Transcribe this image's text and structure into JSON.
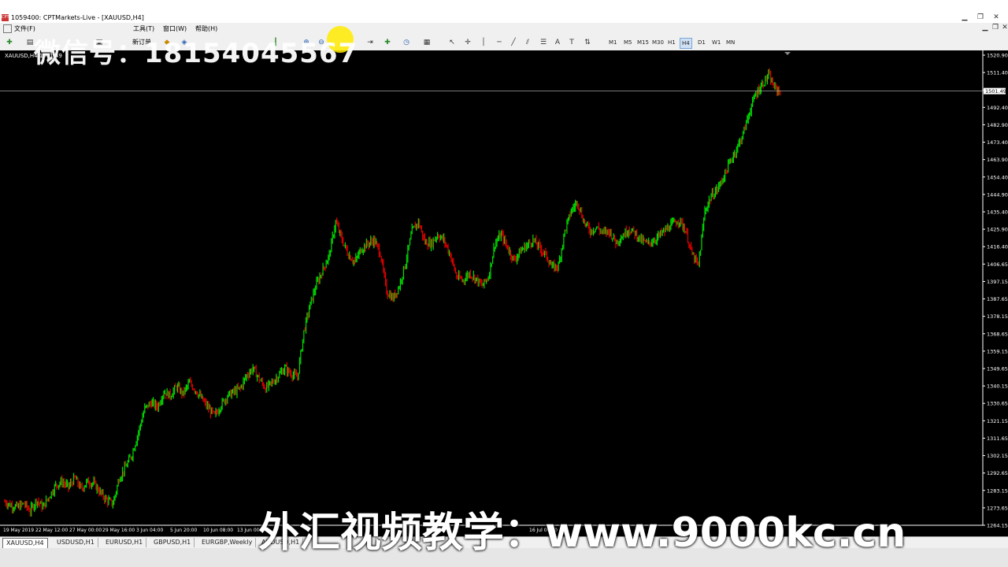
{
  "window": {
    "title": "1059400: CPTMarkets-Live - [XAUUSD,H4]",
    "app_icon_text": "CPT",
    "controls": [
      "▁",
      "❐",
      "✕"
    ],
    "mdi_controls": [
      "▁",
      "❐",
      "✕"
    ]
  },
  "menu": {
    "items": [
      "文件(F)",
      "工具(T)",
      "窗口(W)",
      "帮助(H)"
    ]
  },
  "toolbar": {
    "new_order_label": "新订单",
    "timeframes": [
      "M1",
      "M5",
      "M15",
      "M30",
      "H1",
      "H4",
      "D1",
      "W1",
      "MN"
    ],
    "active_timeframe": "H4"
  },
  "chart": {
    "symbol_header": "XAUUSD,H4  1501.49",
    "current_price": "1501.49",
    "price_ticks": [
      "1520.90",
      "1511.40",
      "1501.49",
      "1492.40",
      "1482.90",
      "1473.40",
      "1463.90",
      "1454.40",
      "1444.90",
      "1435.40",
      "1425.90",
      "1416.40",
      "1406.65",
      "1397.15",
      "1387.65",
      "1378.15",
      "1368.65",
      "1359.15",
      "1349.65",
      "1340.15",
      "1330.65",
      "1321.15",
      "1311.65",
      "1302.15",
      "1292.65",
      "1283.15",
      "1273.65",
      "1264.15"
    ],
    "time_ticks": [
      "19 May 2019",
      "22 May 12:00",
      "27 May 00:00",
      "29 May 16:00",
      "3 Jun 04:00",
      "5 Jun 20:00",
      "10 Jun 08:00",
      "13 Jun 00:00",
      "16 Jul 00:00"
    ],
    "colors": {
      "bull": "#00e000",
      "bear": "#e00000",
      "background": "#000000",
      "grid_line": "#c0c0c0"
    }
  },
  "chart_data": {
    "type": "candlestick",
    "ylim": [
      1264.15,
      1522.0
    ],
    "close_path": [
      1277,
      1275,
      1274,
      1276,
      1272,
      1278,
      1274,
      1280,
      1286,
      1288,
      1285,
      1290,
      1284,
      1288,
      1287,
      1282,
      1278,
      1276,
      1290,
      1296,
      1303,
      1315,
      1328,
      1331,
      1329,
      1337,
      1335,
      1340,
      1336,
      1342,
      1338,
      1333,
      1328,
      1324,
      1330,
      1335,
      1337,
      1339,
      1346,
      1350,
      1344,
      1339,
      1342,
      1346,
      1350,
      1347,
      1345,
      1370,
      1385,
      1396,
      1404,
      1412,
      1430,
      1420,
      1412,
      1408,
      1415,
      1418,
      1420,
      1413,
      1392,
      1388,
      1395,
      1408,
      1425,
      1430,
      1419,
      1418,
      1423,
      1420,
      1412,
      1400,
      1398,
      1402,
      1399,
      1395,
      1400,
      1418,
      1423,
      1416,
      1409,
      1414,
      1417,
      1420,
      1416,
      1412,
      1405,
      1406,
      1425,
      1436,
      1441,
      1430,
      1425,
      1427,
      1424,
      1425,
      1419,
      1422,
      1426,
      1424,
      1420,
      1418,
      1420,
      1423,
      1426,
      1429,
      1431,
      1425,
      1412,
      1406,
      1436,
      1444,
      1448,
      1455,
      1463,
      1470,
      1478,
      1490,
      1500,
      1505,
      1510,
      1503,
      1501
    ]
  },
  "tabs": {
    "items": [
      "XAUUSD,H4",
      "USDUSD,H1",
      "EURUSD,H1",
      "GBPUSD,H1",
      "EURGBP,Weekly",
      "AUDUSD,H1"
    ],
    "active": "XAUUSD,H4"
  },
  "overlay": {
    "watermark": "微信号：18154045567",
    "subtitle": "外汇视频教学：www.9000kc.cn"
  }
}
